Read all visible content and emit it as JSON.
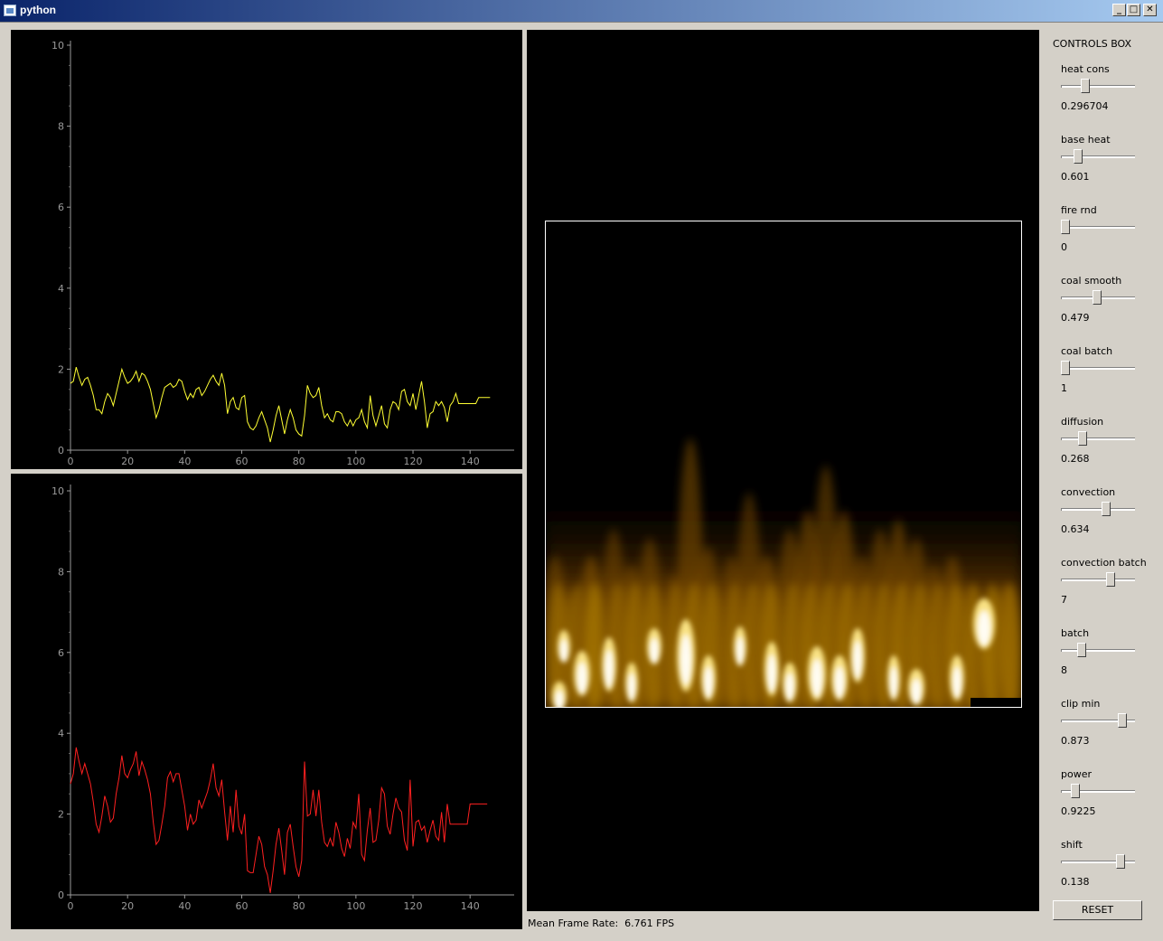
{
  "window": {
    "title": "python"
  },
  "plots": [
    {
      "chart_data": {
        "type": "line",
        "color": "#ffff33",
        "ylim": [
          0,
          10
        ],
        "xlim": [
          0,
          145
        ],
        "yticks": [
          "0",
          "2",
          "4",
          "6",
          "8",
          "10"
        ],
        "xticks": [
          "0",
          "20",
          "40",
          "60",
          "80",
          "100",
          "120",
          "140"
        ],
        "series": [
          {
            "values": [
              1.65,
              1.7,
              2.05,
              1.8,
              1.6,
              1.75,
              1.8,
              1.6,
              1.35,
              1.0,
              1.0,
              0.9,
              1.2,
              1.4,
              1.3,
              1.1,
              1.4,
              1.7,
              2.0,
              1.8,
              1.65,
              1.7,
              1.8,
              1.95,
              1.7,
              1.9,
              1.85,
              1.7,
              1.5,
              1.15,
              0.8,
              1.0,
              1.3,
              1.55,
              1.6,
              1.65,
              1.55,
              1.6,
              1.75,
              1.7,
              1.45,
              1.25,
              1.4,
              1.3,
              1.5,
              1.55,
              1.35,
              1.45,
              1.6,
              1.75,
              1.85,
              1.7,
              1.6,
              1.9,
              1.6,
              0.9,
              1.2,
              1.3,
              1.05,
              1.0,
              1.3,
              1.35,
              0.7,
              0.55,
              0.5,
              0.6,
              0.8,
              0.95,
              0.75,
              0.55,
              0.2,
              0.5,
              0.85,
              1.1,
              0.75,
              0.4,
              0.75,
              1.0,
              0.8,
              0.5,
              0.4,
              0.35,
              0.85,
              1.6,
              1.4,
              1.3,
              1.35,
              1.55,
              1.1,
              0.8,
              0.9,
              0.75,
              0.7,
              0.95,
              0.95,
              0.9,
              0.7,
              0.6,
              0.75,
              0.6,
              0.75,
              0.8,
              1.0,
              0.7,
              0.55,
              1.35,
              0.85,
              0.6,
              0.85,
              1.1,
              0.65,
              0.55,
              1.0,
              1.2,
              1.15,
              1.0,
              1.45,
              1.5,
              1.2,
              1.1,
              1.4,
              1.0,
              1.35,
              1.7,
              1.2,
              0.55,
              0.9,
              0.95,
              1.2,
              1.1,
              1.2,
              1.05,
              0.7,
              1.1,
              1.2,
              1.4,
              1.15,
              1.15,
              1.15,
              1.15,
              1.15,
              1.15,
              1.15,
              1.3,
              1.3,
              1.3,
              1.3,
              1.3
            ]
          }
        ]
      }
    },
    {
      "chart_data": {
        "type": "line",
        "color": "#ff2020",
        "ylim": [
          0,
          10
        ],
        "xlim": [
          0,
          145
        ],
        "yticks": [
          "0",
          "2",
          "4",
          "6",
          "8",
          "10"
        ],
        "xticks": [
          "0",
          "20",
          "40",
          "60",
          "80",
          "100",
          "120",
          "140"
        ],
        "series": [
          {
            "values": [
              2.75,
              3.0,
              3.65,
              3.3,
              3.0,
              3.25,
              3.0,
              2.75,
              2.3,
              1.75,
              1.55,
              1.95,
              2.45,
              2.2,
              1.8,
              1.9,
              2.5,
              2.9,
              3.45,
              3.0,
              2.9,
              3.1,
              3.25,
              3.55,
              2.95,
              3.3,
              3.1,
              2.85,
              2.5,
              1.8,
              1.25,
              1.35,
              1.75,
              2.2,
              2.9,
              3.05,
              2.8,
              3.0,
              3.0,
              2.6,
              2.2,
              1.6,
              2.0,
              1.75,
              1.85,
              2.35,
              2.15,
              2.35,
              2.55,
              2.85,
              3.25,
              2.65,
              2.45,
              2.85,
              2.05,
              1.35,
              2.2,
              1.55,
              2.6,
              1.7,
              1.5,
              2.0,
              0.6,
              0.55,
              0.55,
              1.0,
              1.45,
              1.25,
              0.7,
              0.5,
              0.05,
              0.6,
              1.25,
              1.65,
              1.1,
              0.5,
              1.55,
              1.75,
              1.2,
              0.7,
              0.45,
              0.85,
              3.3,
              1.95,
              2.0,
              2.6,
              1.95,
              2.6,
              1.8,
              1.3,
              1.2,
              1.4,
              1.2,
              1.8,
              1.55,
              1.15,
              0.95,
              1.4,
              1.15,
              1.8,
              1.65,
              2.5,
              1.0,
              0.85,
              1.6,
              2.15,
              1.3,
              1.35,
              1.85,
              2.65,
              2.5,
              1.7,
              1.5,
              2.0,
              2.4,
              2.15,
              2.05,
              1.35,
              1.1,
              2.85,
              1.2,
              1.8,
              1.85,
              1.6,
              1.7,
              1.3,
              1.6,
              1.85,
              1.45,
              1.35,
              2.05,
              1.3,
              2.25,
              1.75,
              1.75,
              1.75,
              1.75,
              1.75,
              1.75,
              1.75,
              2.25,
              2.25,
              2.25,
              2.25,
              2.25,
              2.25,
              2.25
            ]
          }
        ]
      }
    }
  ],
  "framerate": {
    "label": "Mean Frame Rate:",
    "value": "6.761 FPS"
  },
  "controls": {
    "title": "CONTROLS BOX",
    "items": [
      {
        "label": "heat cons",
        "value": "0.296704",
        "level": 0.3
      },
      {
        "label": "base heat",
        "value": "0.601",
        "level": 0.2
      },
      {
        "label": "fire rnd",
        "value": "0",
        "level": 0.0
      },
      {
        "label": "coal smooth",
        "value": "0.479",
        "level": 0.48
      },
      {
        "label": "coal batch",
        "value": "1",
        "level": 0.0
      },
      {
        "label": "diffusion",
        "value": "0.268",
        "level": 0.27
      },
      {
        "label": "convection",
        "value": "0.634",
        "level": 0.63
      },
      {
        "label": "convection batch",
        "value": "7",
        "level": 0.7
      },
      {
        "label": "batch",
        "value": "8",
        "level": 0.25
      },
      {
        "label": "clip min",
        "value": "0.873",
        "level": 0.87
      },
      {
        "label": "power",
        "value": "0.9225",
        "level": 0.15
      },
      {
        "label": "shift",
        "value": "0.138",
        "level": 0.85
      }
    ],
    "reset_label": "RESET"
  }
}
